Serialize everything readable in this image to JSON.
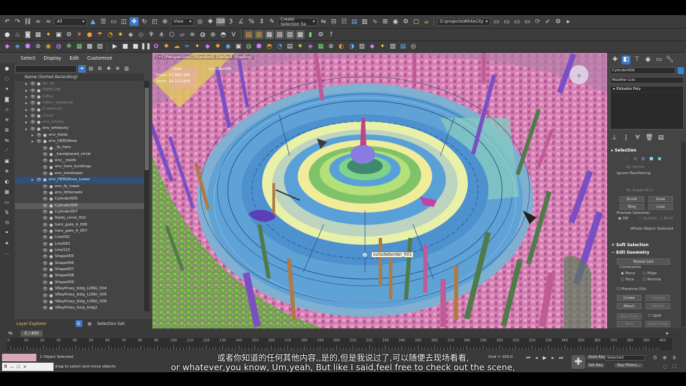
{
  "toolbar": {
    "selection_filter": "All",
    "viewport_dropdown": "View",
    "named_selection": "Create Selection Se",
    "project_path": "D:\\projects\\WhiteCity"
  },
  "scene_explorer": {
    "menu": [
      "Select",
      "Display",
      "Edit",
      "Customize"
    ],
    "column_header": "Name (Sorted Ascending)",
    "rows": [
      {
        "label": "fgr_lig",
        "indent": 1,
        "style": "dim"
      },
      {
        "label": "FREECAM",
        "indent": 1,
        "style": "dim"
      },
      {
        "label": "hdfeu",
        "indent": 1,
        "style": "dim"
      },
      {
        "label": "hdfeu_lightlamp",
        "indent": 1,
        "style": "dim"
      },
      {
        "label": "0 (default)",
        "indent": 1,
        "style": "dim"
      },
      {
        "label": "Cloud",
        "indent": 1,
        "style": "dim"
      },
      {
        "label": "env_whitey",
        "indent": 1,
        "style": "dim"
      },
      {
        "label": "env_whitecity",
        "indent": 1,
        "style": ""
      },
      {
        "label": "env_fields",
        "indent": 2,
        "style": ""
      },
      {
        "label": "env_HEROArea",
        "indent": 2,
        "style": ""
      },
      {
        "label": "_fp_hero",
        "indent": 3,
        "style": ""
      },
      {
        "label": "_handplaced_circle",
        "indent": 3,
        "style": ""
      },
      {
        "label": "env__roads",
        "indent": 3,
        "style": ""
      },
      {
        "label": "env_hero_buildings",
        "indent": 3,
        "style": ""
      },
      {
        "label": "env_herotower",
        "indent": 3,
        "style": ""
      },
      {
        "label": "env_HEROArea_Lower",
        "indent": 2,
        "style": "hl"
      },
      {
        "label": "env_fp_lower",
        "indent": 3,
        "style": ""
      },
      {
        "label": "env_littleroads",
        "indent": 3,
        "style": ""
      },
      {
        "label": "Cylinder005",
        "indent": 3,
        "style": ""
      },
      {
        "label": "Cylinder006",
        "indent": 3,
        "style": "sl"
      },
      {
        "label": "Cylinder007",
        "indent": 3,
        "style": ""
      },
      {
        "label": "fields_circle_002",
        "indent": 3,
        "style": ""
      },
      {
        "label": "hero_gate_A_006",
        "indent": 3,
        "style": ""
      },
      {
        "label": "hero_gate_A_007",
        "indent": 3,
        "style": ""
      },
      {
        "label": "Line092",
        "indent": 3,
        "style": ""
      },
      {
        "label": "Line093",
        "indent": 3,
        "style": ""
      },
      {
        "label": "Line115",
        "indent": 3,
        "style": ""
      },
      {
        "label": "Shape005",
        "indent": 3,
        "style": ""
      },
      {
        "label": "Shape006",
        "indent": 3,
        "style": ""
      },
      {
        "label": "Shape007",
        "indent": 3,
        "style": ""
      },
      {
        "label": "Shape008",
        "indent": 3,
        "style": ""
      },
      {
        "label": "Shape009",
        "indent": 3,
        "style": ""
      },
      {
        "label": "VRayProxy_bldg_LONG_004",
        "indent": 3,
        "style": ""
      },
      {
        "label": "VRayProxy_bldg_LONG_005",
        "indent": 3,
        "style": ""
      },
      {
        "label": "VRayProxy_bldg_LONG_006",
        "indent": 3,
        "style": ""
      },
      {
        "label": "VRayProxy_long_bldg2",
        "indent": 3,
        "style": ""
      }
    ],
    "bottom_label": "Layer Explorer",
    "selection_set_label": "Selection Set:"
  },
  "viewport": {
    "label": "[+] [Perspective] [Standard] [Default Shading]",
    "stats": [
      "Total",
      "Polys: 27,890,180",
      "Verts: 14,112,800"
    ],
    "stats_object": "Cylinder006",
    "tooltip": "outsideborder_001"
  },
  "command_panel": {
    "object_name": "Cylinder006",
    "object_color": "#2a8bdc",
    "modifier_list": "Modifier List",
    "stack_item": "Editable Poly",
    "sections": {
      "selection": "Selection",
      "by_vertex": "By Vertex",
      "ignore_backfacing": "Ignore Backfacing",
      "by_angle": "By Angle:",
      "angle_value": "45.0",
      "shrink": "Shrink",
      "grow": "Grow",
      "ring": "Ring",
      "loop": "Loop",
      "preview_selection": "Preview Selection",
      "off": "Off",
      "subobj": "SubObj",
      "multi": "Multi",
      "whole_object_selected": "Whole Object Selected",
      "soft_selection": "Soft Selection",
      "edit_geometry": "Edit Geometry",
      "repeat_last": "Repeat Last",
      "constraints": "Constraints",
      "none": "None",
      "edge": "Edge",
      "face": "Face",
      "normal": "Normal",
      "preserve_uvs": "Preserve UVs",
      "create": "Create",
      "collapse": "Collapse",
      "attach": "Attach",
      "detach": "Detach",
      "slice_plane": "Slice Plane",
      "split": "Split",
      "slice": "Slice",
      "reset_plane": "Reset Plane"
    }
  },
  "timeline": {
    "frame_readout": "0 / 400",
    "ticks": [
      "0",
      "10",
      "20",
      "30",
      "40",
      "50",
      "60",
      "70",
      "80",
      "90",
      "100",
      "110",
      "120",
      "130",
      "140",
      "150",
      "160",
      "170",
      "180",
      "190",
      "200",
      "210",
      "220",
      "230",
      "240",
      "250",
      "260",
      "270",
      "280",
      "290",
      "300",
      "310",
      "320",
      "330",
      "340",
      "350",
      "360",
      "370",
      "380",
      "390",
      "400"
    ]
  },
  "status": {
    "objects_selected": "1 Object Selected",
    "prompt": "drag to select and move objects",
    "grid": "Grid = 100,0",
    "auto_key": "Auto Key",
    "set_key": "Set Key",
    "selected": "Selected",
    "key_filters": "Key Filters..."
  },
  "subtitles": {
    "cn": "或者你知道的任何其他内容,,是的,但是我说过了,可以随便去现场看看,",
    "en": "or whatever,you know, Um,yeah, But like I said,feel free to check out the scene,"
  }
}
